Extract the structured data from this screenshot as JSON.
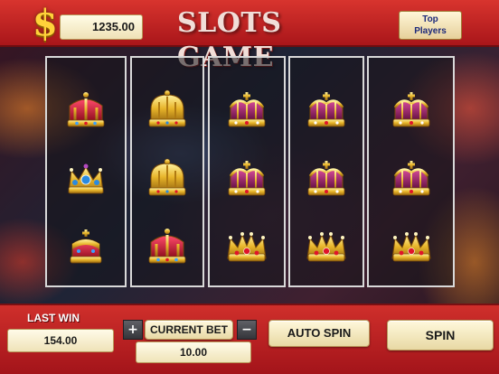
{
  "header": {
    "currency_symbol": "$",
    "balance": "1235.00",
    "title": "SLOTS GAME",
    "top_players_line1": "Top",
    "top_players_line2": "Players"
  },
  "reels": [
    [
      "crown-red",
      "crown-blue",
      "crown-red-small"
    ],
    [
      "crown-gold-dome",
      "crown-gold-dome",
      "crown-red"
    ],
    [
      "crown-purple",
      "crown-purple",
      "crown-gold-spiked"
    ],
    [
      "crown-purple",
      "crown-purple",
      "crown-gold-spiked"
    ],
    [
      "crown-purple",
      "crown-purple",
      "crown-gold-spiked"
    ]
  ],
  "controls": {
    "last_win_label": "LAST WIN",
    "last_win_value": "154.00",
    "plus": "+",
    "current_bet_label": "CURRENT BET",
    "minus": "−",
    "current_bet_value": "10.00",
    "auto_spin_label": "AUTO SPIN",
    "spin_label": "SPIN"
  },
  "colors": {
    "bar_red": "#c82a27",
    "gold": "#ffd23a",
    "button_tan": "#f3e6b8",
    "crown_gold": "#e8b52a",
    "gem_red": "#c8122a",
    "gem_blue": "#2a8ae0",
    "crown_purple": "#8c1a5a"
  }
}
